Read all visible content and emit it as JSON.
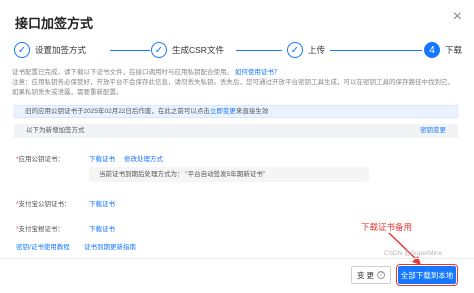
{
  "dialog": {
    "title": "接口加签方式",
    "close_glyph": "×"
  },
  "steps": [
    {
      "number": "✓",
      "label": "设置加签方式",
      "state": "done"
    },
    {
      "number": "✓",
      "label": "生成CSR文件",
      "state": "done"
    },
    {
      "number": "✓",
      "label": "上传",
      "state": "done"
    },
    {
      "number": "4",
      "label": "下载",
      "state": "active"
    }
  ],
  "notice": {
    "line1_prefix": "证书配置已完成，请下载以下证书文件，在接口调用时与应用私钥配合使用。",
    "line1_link": "如何使用证书？",
    "line2": "注意：应用私钥务必保管好，开放平台不会保存此信息，请勿丢失私钥。丢失后，您可通过开放平台密钥工具生成，可以在密钥工具的保存路径中找到它。如果私钥丢失或泄露，需要重新配置。"
  },
  "info_bar": {
    "prefix": "旧的应用公钥证书于2025年02月22日后作废，在此之前可以点击",
    "link": "立即变更",
    "suffix": "来直接生效"
  },
  "section_bar": {
    "left": "以下为新增加签方式",
    "right": "密钥变更"
  },
  "app_cert": {
    "required_mark": "*",
    "label": "应用公钥证书：",
    "download_link": "下载证书",
    "fix_link": "修改处理方式",
    "tip": "当前证书到期后处理方式为：  \"平台自动签发5年期新证书\""
  },
  "alipay_cert": {
    "required_mark": "*",
    "label": "支付宝公钥证书：",
    "download_link": "下载证书"
  },
  "alipay_root_cert": {
    "required_mark": "*",
    "label": "支付宝根证书：",
    "download_link": "下载证书"
  },
  "help_links": {
    "usage": "密钥/证书使用教程",
    "expire": "证书到期更新指南"
  },
  "annotation": {
    "text": "下载证书备用",
    "color": "#e53935"
  },
  "watermark": "CSDN @SuperMine",
  "footer": {
    "change_label": "变 更",
    "help_icon": "?",
    "download_all_label": "全部下载到本地"
  },
  "colors": {
    "primary": "#1677ff",
    "annotation": "#e53935"
  }
}
